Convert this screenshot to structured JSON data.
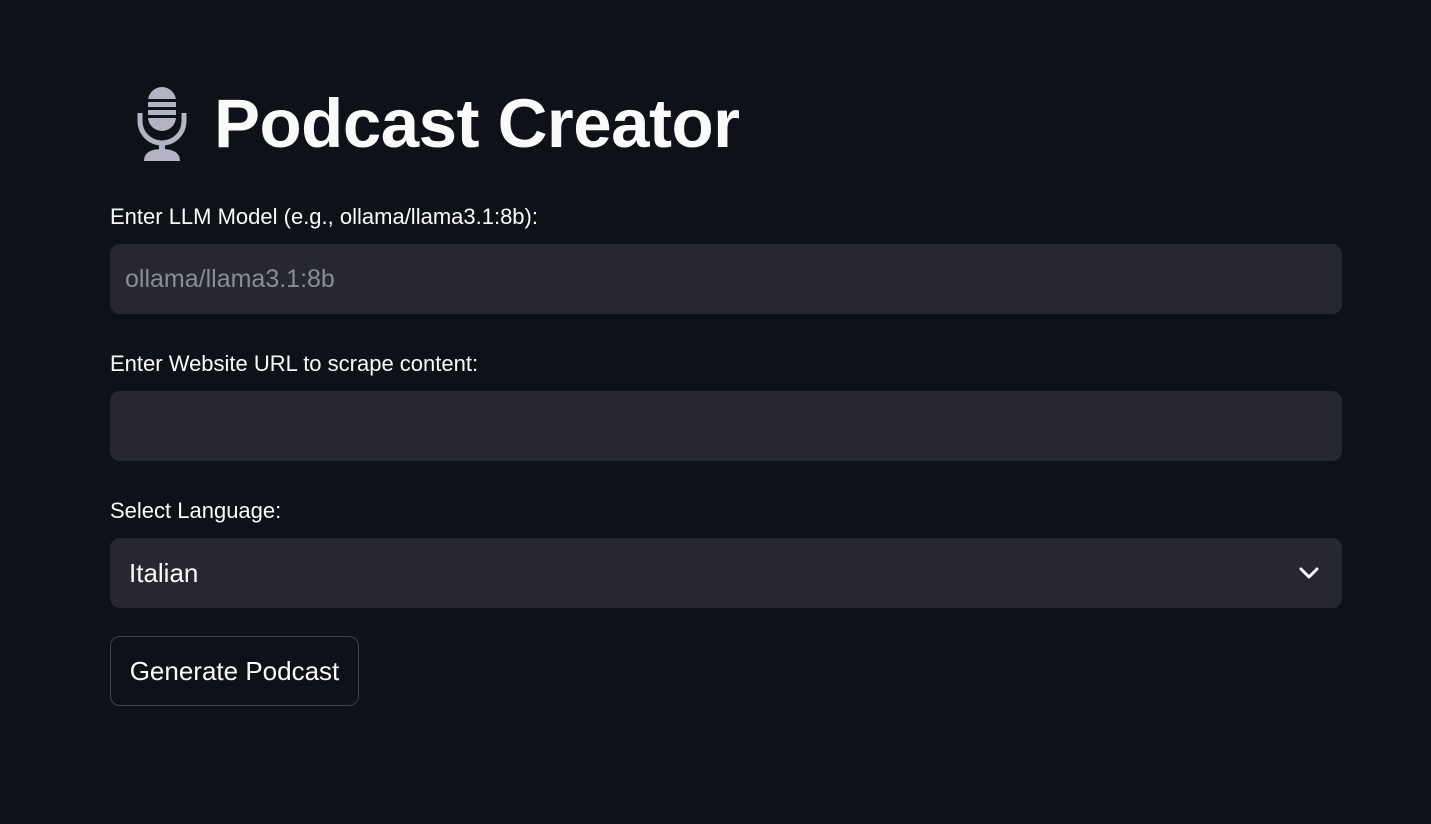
{
  "header": {
    "icon": "microphone-icon",
    "title": "Podcast Creator"
  },
  "form": {
    "model": {
      "label": "Enter LLM Model (e.g., ollama/llama3.1:8b):",
      "value": "",
      "placeholder": "ollama/llama3.1:8b"
    },
    "url": {
      "label": "Enter Website URL to scrape content:",
      "value": "",
      "placeholder": ""
    },
    "language": {
      "label": "Select Language:",
      "selected": "Italian"
    },
    "generate_label": "Generate Podcast"
  },
  "colors": {
    "background": "#0e1117",
    "field_background": "#262730",
    "text": "#fafafa",
    "placeholder": "#8a8c95",
    "icon": "#b4b3c4"
  }
}
